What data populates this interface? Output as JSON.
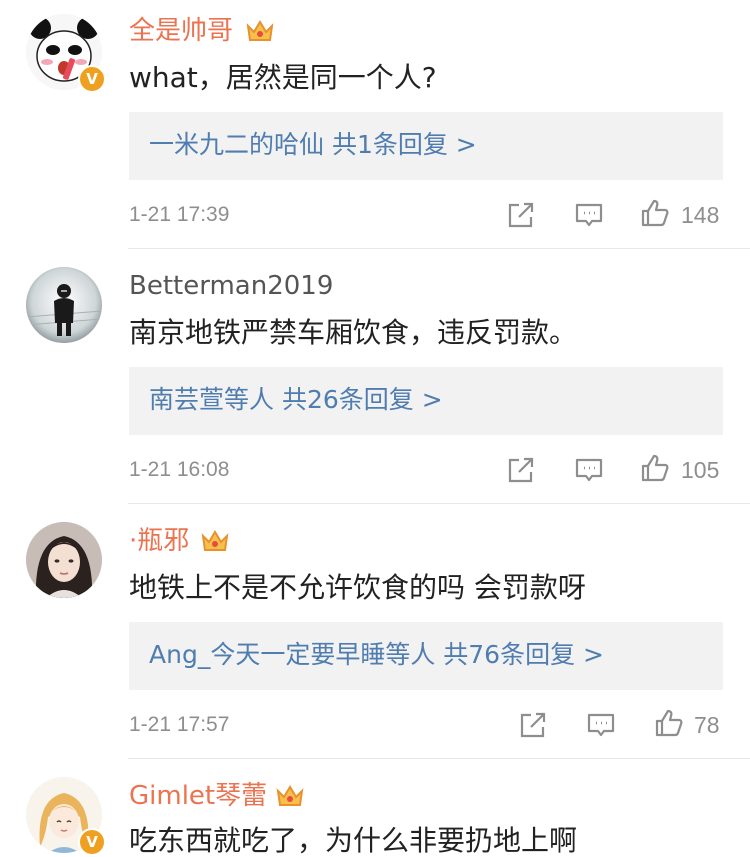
{
  "comments": [
    {
      "username": "全是帅哥",
      "text": "what，居然是同一个人?",
      "replies": "一米九二的哈仙  共1条回复 >",
      "time": "1-21 17:39",
      "likes": "148",
      "verified_badge": "V"
    },
    {
      "username": "Betterman2019",
      "text": "南京地铁严禁车厢饮食，违反罚款。",
      "replies": "南芸萱等人  共26条回复 >",
      "time": "1-21 16:08",
      "likes": "105"
    },
    {
      "username": "·瓶邪",
      "text": "地铁上不是不允许饮食的吗 会罚款呀",
      "replies": "Ang_今天一定要早睡等人  共76条回复 >",
      "time": "1-21 17:57",
      "likes": "78"
    },
    {
      "username": "Gimlet琴蕾",
      "text": "吃东西就吃了，为什么非要扔地上啊",
      "verified_badge": "V"
    }
  ],
  "icons": {
    "share": "share-icon",
    "comment": "comment-icon",
    "like": "thumbs-up-icon",
    "vip": "crown-icon"
  },
  "colors": {
    "vip_name": "#eb7350",
    "reply_link": "#507daf",
    "meta": "#8e8e8e",
    "reply_bg": "#f2f2f2"
  }
}
